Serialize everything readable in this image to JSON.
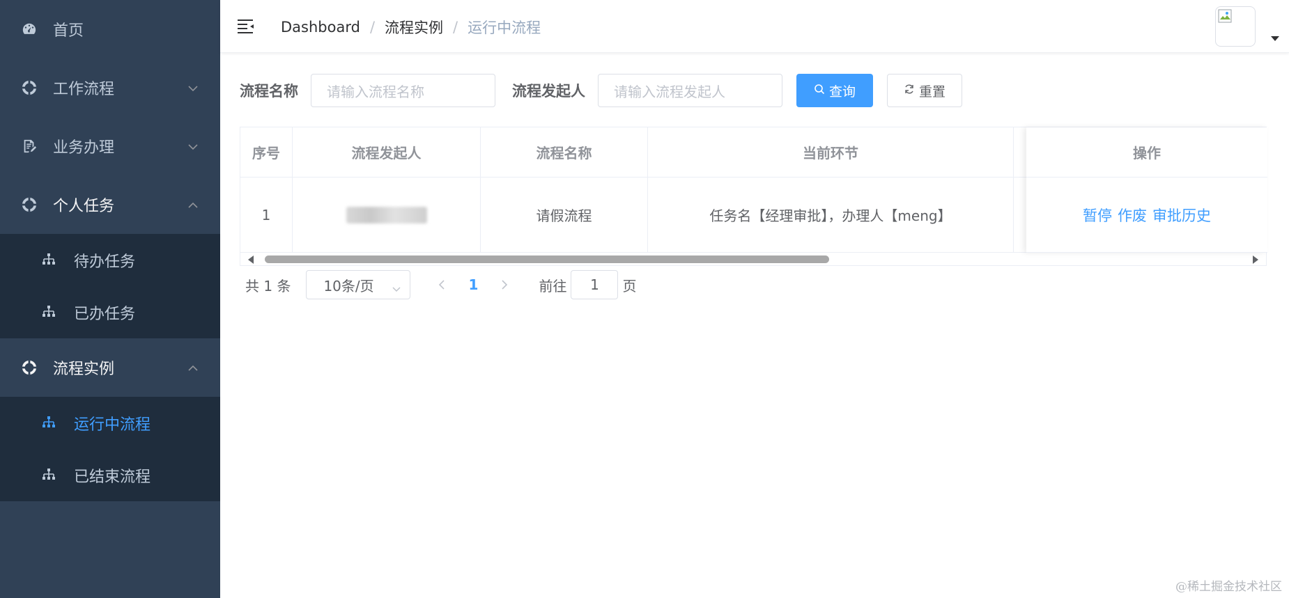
{
  "sidebar": {
    "items": [
      {
        "label": "首页",
        "icon": "dashboard-icon"
      },
      {
        "label": "工作流程",
        "icon": "workflow-icon",
        "chevron": "down"
      },
      {
        "label": "业务办理",
        "icon": "document-edit-icon",
        "chevron": "down"
      },
      {
        "label": "个人任务",
        "icon": "workflow-icon",
        "chevron": "up",
        "children": [
          {
            "label": "待办任务"
          },
          {
            "label": "已办任务"
          }
        ]
      },
      {
        "label": "流程实例",
        "icon": "workflow-icon",
        "chevron": "up",
        "children": [
          {
            "label": "运行中流程",
            "active": true
          },
          {
            "label": "已结束流程"
          }
        ]
      }
    ]
  },
  "navbar": {
    "breadcrumb": [
      "Dashboard",
      "流程实例",
      "运行中流程"
    ],
    "separator": "/"
  },
  "search": {
    "name_label": "流程名称",
    "name_placeholder": "请输入流程名称",
    "initiator_label": "流程发起人",
    "initiator_placeholder": "请输入流程发起人",
    "query_button": "查询",
    "reset_button": "重置"
  },
  "table": {
    "columns": [
      "序号",
      "流程发起人",
      "流程名称",
      "当前环节",
      "操作"
    ],
    "rows": [
      {
        "index": "1",
        "initiator": "",
        "name": "请假流程",
        "current_step": "任务名【经理审批】，办理人【meng】",
        "actions": [
          "暂停",
          "作废",
          "审批历史"
        ]
      }
    ]
  },
  "pagination": {
    "total": "共 1 条",
    "page_size": "10条/页",
    "current_page": "1",
    "goto_prefix": "前往",
    "goto_value": "1",
    "goto_suffix": "页"
  },
  "watermark": "@稀土掘金技术社区",
  "colors": {
    "sidebar_bg": "#304156",
    "submenu_bg": "#1f2d3d",
    "sidebar_text": "#bfcbd9",
    "accent": "#409eff"
  }
}
